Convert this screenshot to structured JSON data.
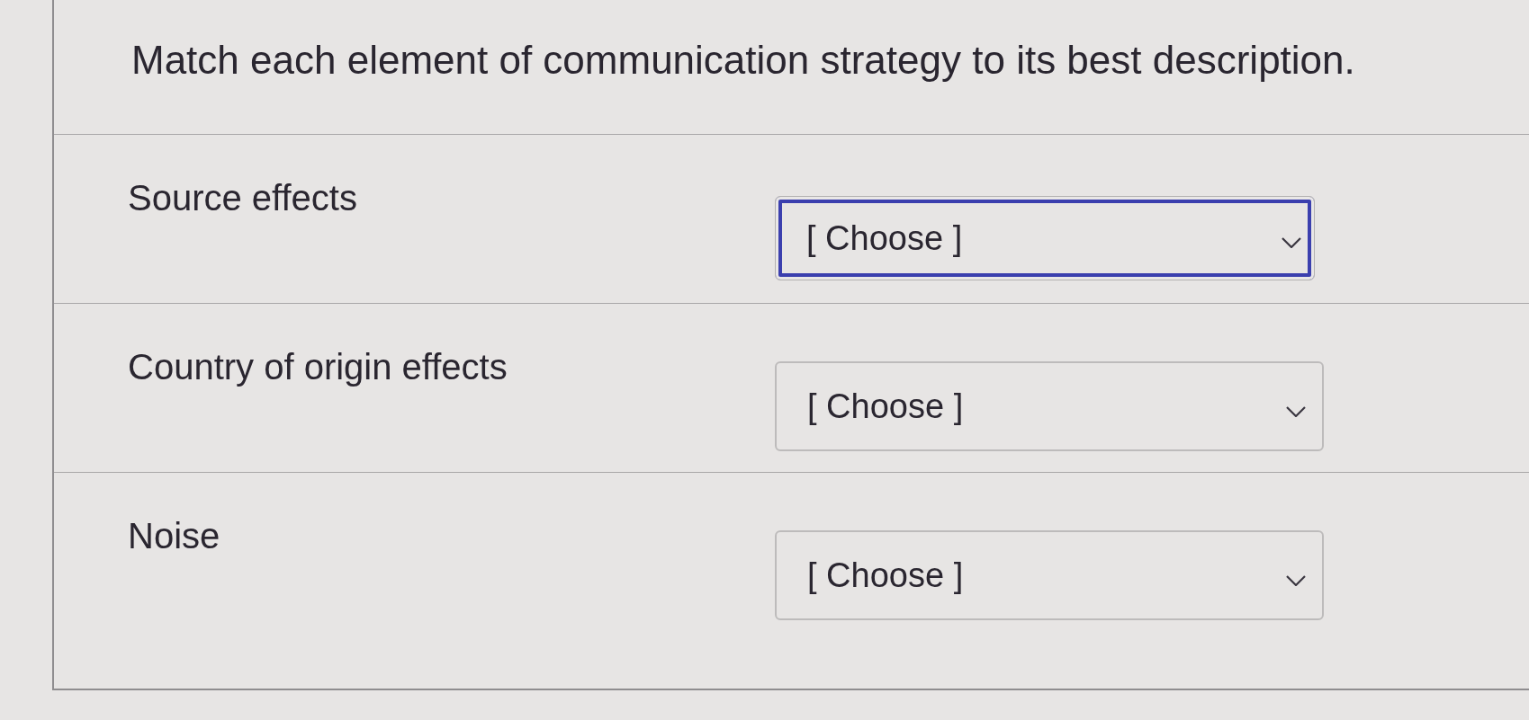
{
  "question": {
    "prompt": "Match each element of communication strategy to its best description."
  },
  "rows": [
    {
      "label": "Source effects",
      "dropdown": {
        "value": "[ Choose ]",
        "focused": true
      }
    },
    {
      "label": "Country of origin effects",
      "dropdown": {
        "value": "[ Choose ]",
        "focused": false
      }
    },
    {
      "label": "Noise",
      "dropdown": {
        "value": "[ Choose ]",
        "focused": false
      }
    }
  ]
}
